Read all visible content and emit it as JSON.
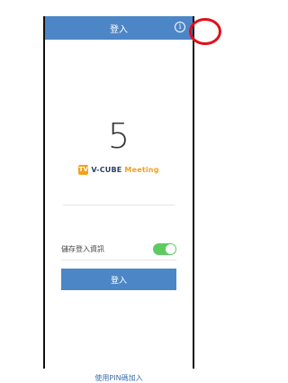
{
  "header": {
    "title": "登入"
  },
  "icons": {
    "info": "info-icon"
  },
  "code_display": {
    "digit": "5"
  },
  "logo": {
    "mark": "TV",
    "brand": "V-CUBE",
    "product": "Meeting"
  },
  "settings": {
    "remember_label": "儲存登入資訊",
    "remember_enabled": true
  },
  "actions": {
    "login_label": "登入",
    "pin_link_label": "使用PIN碼加入"
  },
  "colors": {
    "primary": "#4d86c6",
    "toggle_on": "#5ecb62",
    "logo_accent": "#f2a21b",
    "annotation": "#e0101a"
  }
}
